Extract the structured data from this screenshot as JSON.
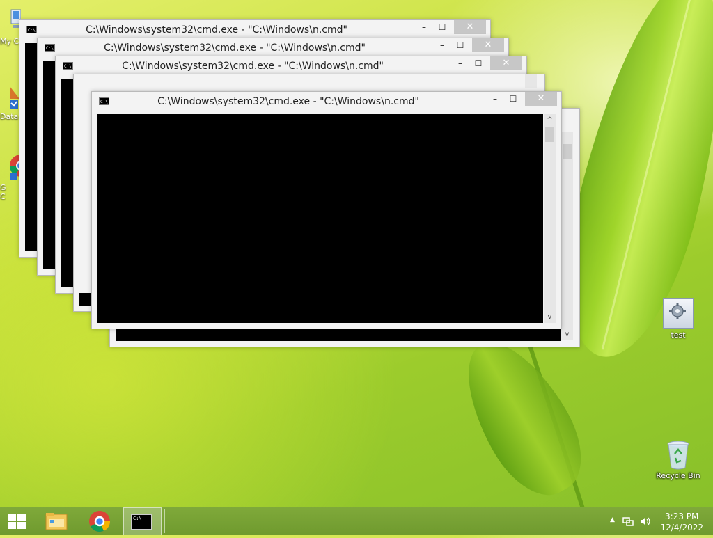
{
  "desktop": {
    "icons": [
      {
        "label": "test",
        "icon": "gear-file-icon"
      },
      {
        "label": "Recycle Bin",
        "icon": "recycle-bin-icon"
      }
    ],
    "edge_fragments": {
      "my_computer": "My C",
      "data": "Data",
      "chrome_a": "G",
      "chrome_b": "C"
    }
  },
  "windows": [
    {
      "title": "C:\\Windows\\system32\\cmd.exe - \"C:\\Windows\\n.cmd\""
    },
    {
      "title": "C:\\Windows\\system32\\cmd.exe - \"C:\\Windows\\n.cmd\""
    },
    {
      "title": "C:\\Windows\\system32\\cmd.exe - \"C:\\Windows\\n.cmd\""
    },
    {
      "title": "C:\\Windows\\system32\\cmd.exe - \"C:\\Windows\\n.cmd\""
    }
  ],
  "window_controls": {
    "minimize": "–",
    "maximize": "☐",
    "close": "✕",
    "scroll_up": "^",
    "scroll_down": "v"
  },
  "console_icon_text": "C:\\",
  "taskbar": {
    "items": [
      "Start",
      "File Explorer",
      "Google Chrome",
      "Command Prompt"
    ],
    "cmd_preview": "C:\\_",
    "tray_arrow": "▲",
    "clock": {
      "time": "3:23 PM",
      "date": "12/4/2022"
    }
  },
  "colors": {
    "taskbar": "#7fa93a",
    "console_bg": "#000000",
    "close_button": "#c7c7c7",
    "window_frame": "#f3f3f3"
  }
}
